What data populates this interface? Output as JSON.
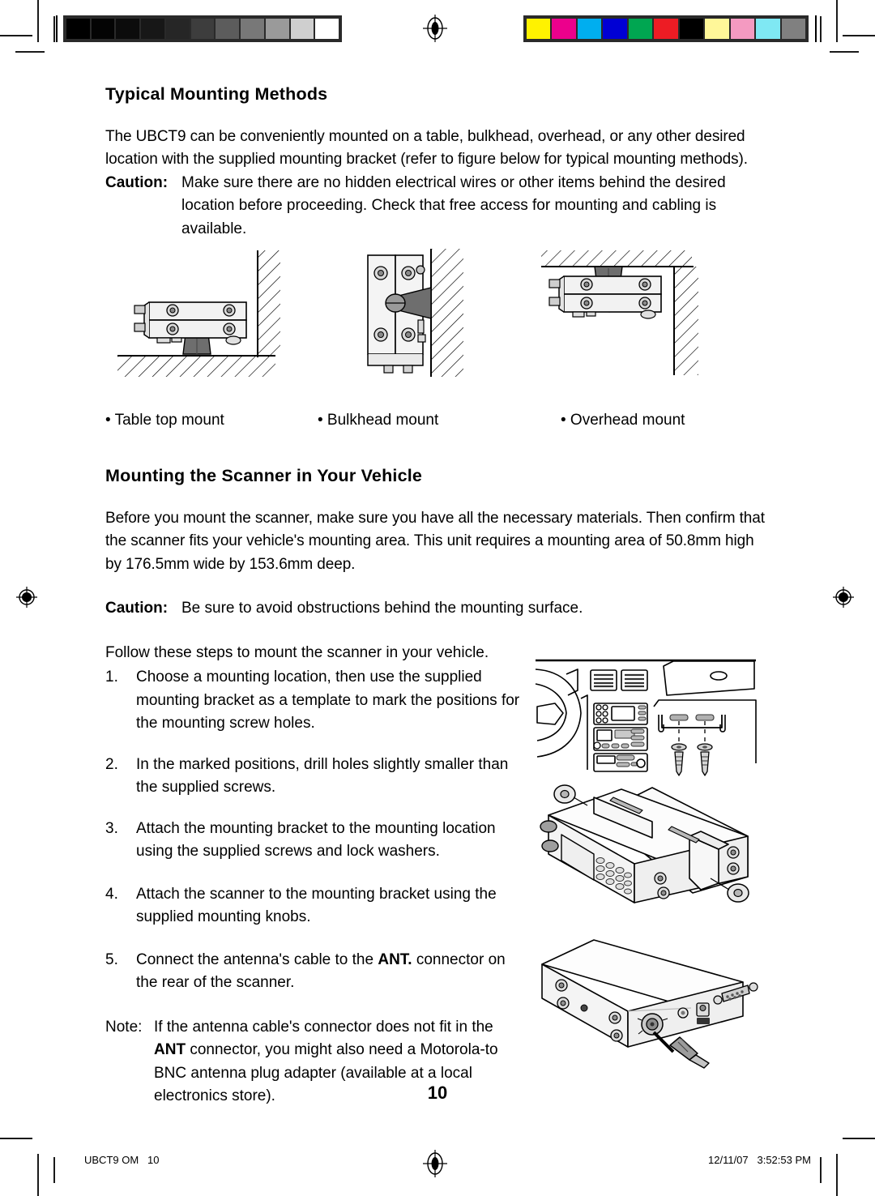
{
  "document": {
    "page_number": "10",
    "footer_left": "UBCT9 OM   10",
    "footer_right": "12/11/07   3:52:53 PM"
  },
  "sections": [
    {
      "heading": "Typical Mounting Methods",
      "paragraph": "The UBCT9 can be conveniently mounted on a table, bulkhead, overhead, or any other desired location with the supplied mounting bracket (refer to figure below for typical mounting methods).",
      "caution_label": "Caution:",
      "caution_text": "Make sure there are no hidden electrical wires or other items behind the desired location before proceeding. Check that free access for mounting and cabling is available.",
      "figure_captions": [
        "• Table top mount",
        "• Bulkhead mount",
        "• Overhead mount"
      ]
    },
    {
      "heading": "Mounting the Scanner in Your Vehicle",
      "paragraph": "Before you mount the scanner, make sure you have all the necessary materials. Then confirm that the scanner fits your vehicle's mounting area. This unit requires a mounting area of 50.8mm high by 176.5mm wide by 153.6mm deep.",
      "caution_label": "Caution:",
      "caution_text": "Be sure to avoid obstructions behind the mounting surface.",
      "intro": "Follow these steps to mount the scanner in your vehicle.",
      "steps": [
        {
          "num": "1.",
          "text": "Choose a mounting location, then use the supplied mounting bracket as a template to mark the positions for the mounting screw holes."
        },
        {
          "num": "2.",
          "text": "In the marked positions, drill holes slightly smaller than the supplied screws."
        },
        {
          "num": "3.",
          "text": "Attach the mounting bracket to the mounting location using the supplied screws and lock washers."
        },
        {
          "num": "4.",
          "text": "Attach the scanner to the mounting bracket using the supplied mounting knobs."
        }
      ],
      "step5": {
        "num": "5.",
        "text_before": "Connect the antenna's cable to the ",
        "bold": "ANT.",
        "text_after": " connector on the rear of the scanner."
      },
      "note": {
        "label": "Note:",
        "text_before": "If the antenna cable's connector does not fit in the ",
        "bold": "ANT",
        "text_after": " connector, you might also need a Motorola-to BNC antenna plug adapter (available at a local electronics store)."
      }
    }
  ],
  "calibration": {
    "grayscale": [
      "#000000",
      "#040404",
      "#0c0c0c",
      "#171717",
      "#262626",
      "#3d3d3d",
      "#5c5c5c",
      "#787878",
      "#9a9a9a",
      "#cfcfcf",
      "#ffffff"
    ],
    "colors": [
      "#fff200",
      "#ec008c",
      "#00aeef",
      "#0000d4",
      "#00a651",
      "#ed1c24",
      "#000000",
      "#fff799",
      "#f49ac1",
      "#7fe8f3",
      "#808080"
    ]
  }
}
